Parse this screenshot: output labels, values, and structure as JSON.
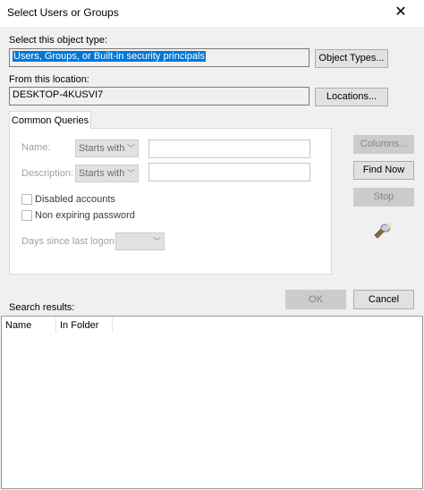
{
  "window": {
    "title": "Select Users or Groups",
    "close_glyph": "✕"
  },
  "object_type": {
    "label": "Select this object type:",
    "value": "Users, Groups, or Built-in security principals",
    "button": "Object Types..."
  },
  "location": {
    "label": "From this location:",
    "value": "DESKTOP-4KUSVI7",
    "button": "Locations..."
  },
  "tabs": [
    {
      "label": "Common Queries"
    }
  ],
  "queries": {
    "name_label": "Name:",
    "name_mode": "Starts with",
    "description_label": "Description:",
    "description_mode": "Starts with",
    "disabled_accounts": "Disabled accounts",
    "non_expiring_password": "Non expiring password",
    "days_label": "Days since last logon:",
    "days_value": ""
  },
  "side_buttons": {
    "columns": "Columns...",
    "find_now": "Find Now",
    "stop": "Stop"
  },
  "footer_buttons": {
    "ok": "OK",
    "cancel": "Cancel"
  },
  "results": {
    "label": "Search results:",
    "columns": [
      "Name",
      "In Folder"
    ]
  },
  "colors": {
    "selection": "#0078d7",
    "window_bg": "#f0f0f0"
  }
}
